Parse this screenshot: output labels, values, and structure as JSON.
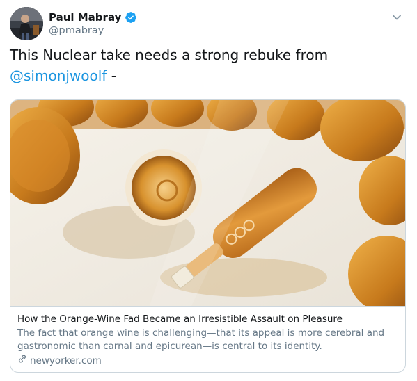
{
  "author": {
    "display_name": "Paul Mabray",
    "handle": "@pmabray",
    "verified_icon": "verified-badge-icon"
  },
  "tweet": {
    "text_before": "This Nuclear take needs a strong rebuke from",
    "mention": "@simonjwoolf",
    "text_after": " -"
  },
  "card": {
    "title": "How the Orange-Wine Fad Became an Irresistible Assault on Pleasure",
    "description": "The fact that orange wine is challenging—that its appeal is more cerebral and gastronomic than carnal and epicurean—is central to its identity.",
    "domain": "newyorker.com",
    "link_icon": "link-icon"
  },
  "colors": {
    "accent": "#1b95e0",
    "secondary_text": "#657786",
    "border": "#ccd6dd",
    "wine": "#c77a1c"
  }
}
